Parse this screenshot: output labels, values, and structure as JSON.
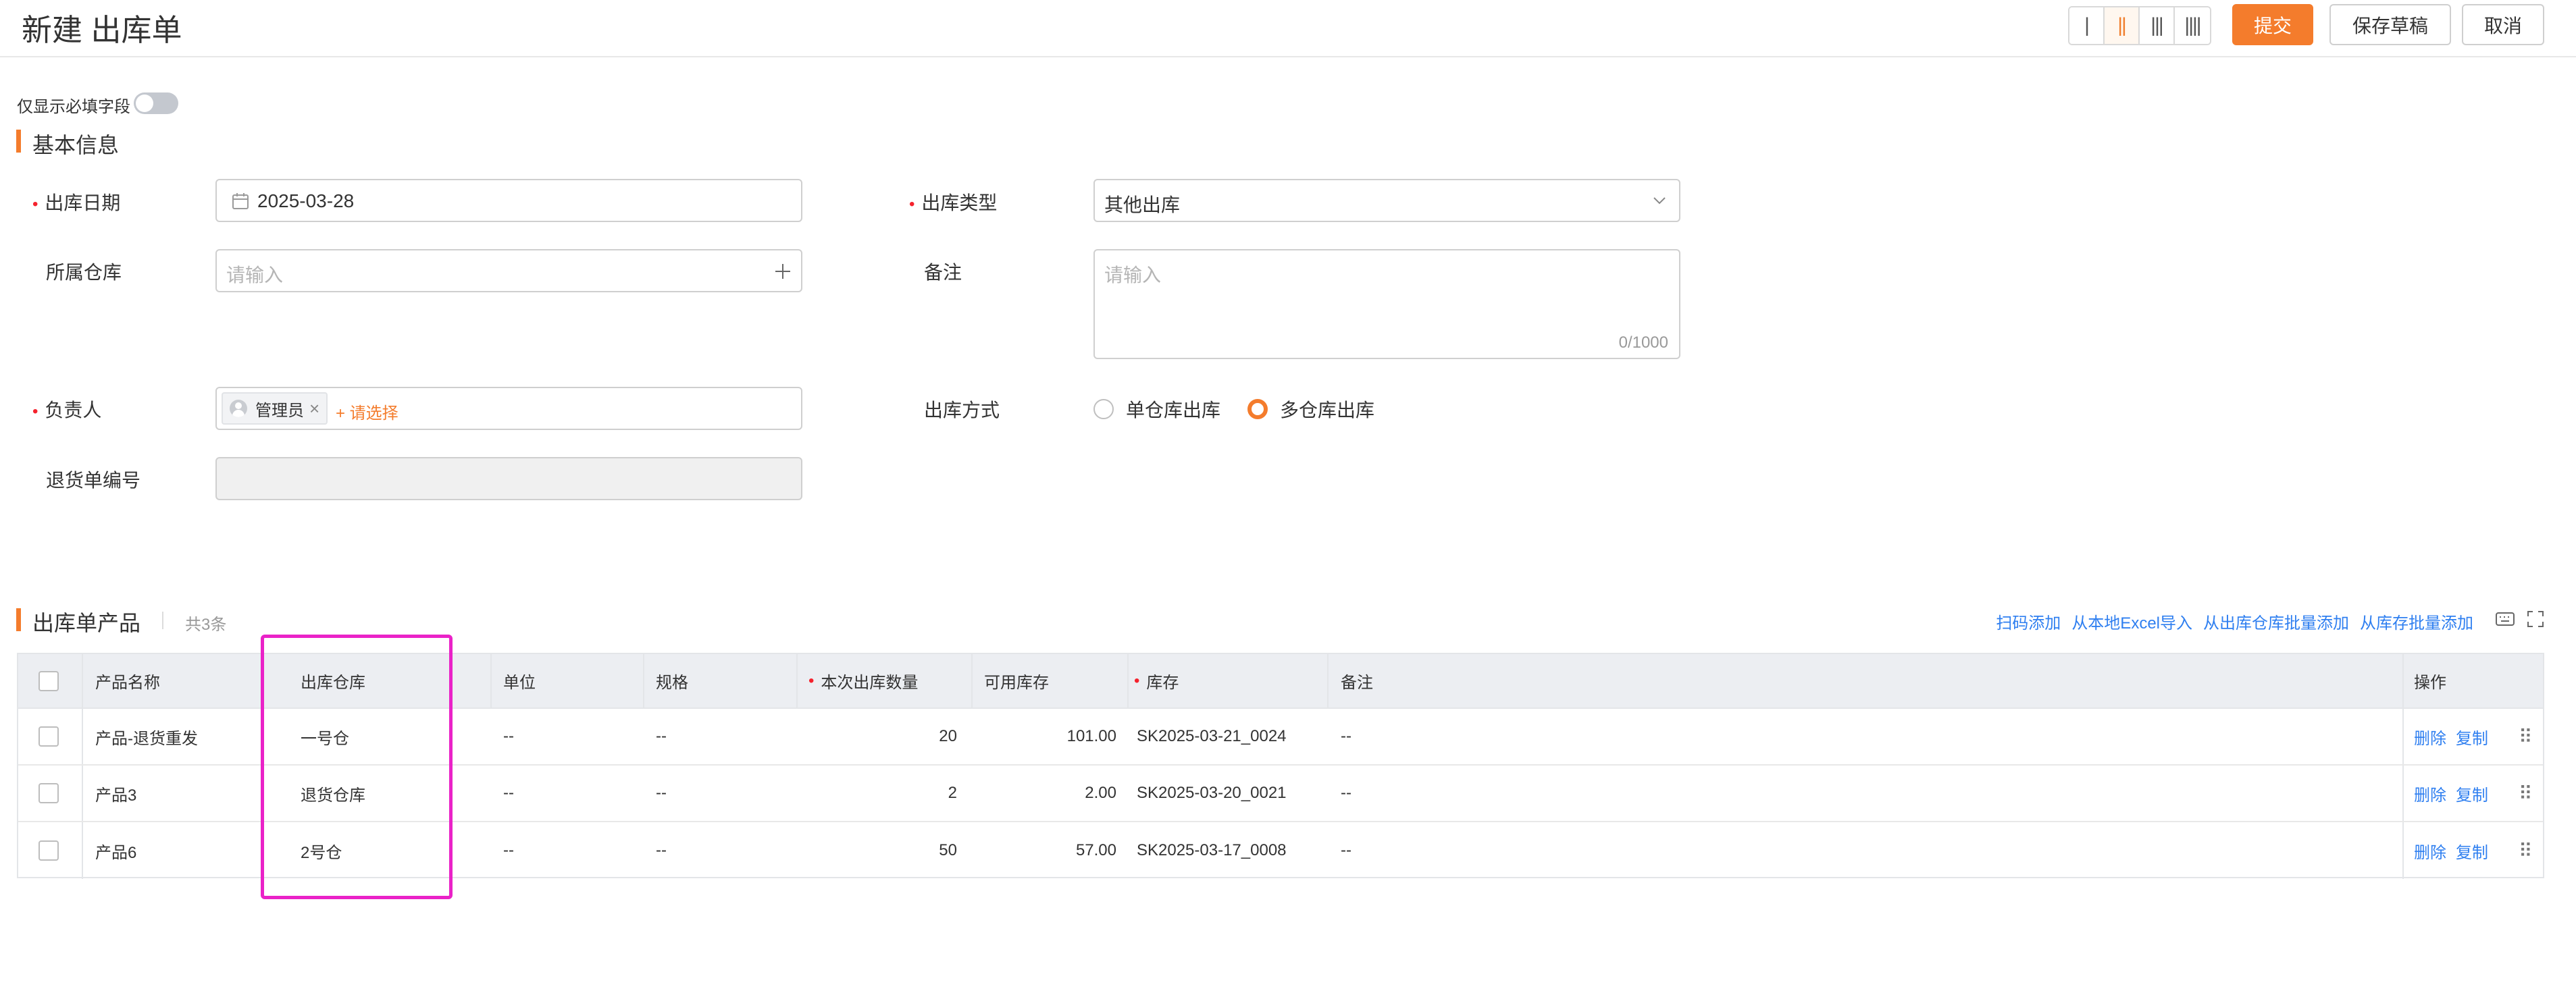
{
  "page": {
    "title": "新建 出库单"
  },
  "toolbar": {
    "layouts": [
      "|",
      "||",
      "|||",
      "||||"
    ],
    "submit": "提交",
    "save_draft": "保存草稿",
    "cancel": "取消"
  },
  "required_toggle": {
    "label": "仅显示必填字段"
  },
  "basic_info": {
    "title": "基本信息",
    "out_date": {
      "label": "出库日期",
      "value": "2025-03-28"
    },
    "out_type": {
      "label": "出库类型",
      "value": "其他出库"
    },
    "warehouse": {
      "label": "所属仓库",
      "placeholder": "请输入"
    },
    "remark": {
      "label": "备注",
      "placeholder": "请输入",
      "counter": "0/1000"
    },
    "owner": {
      "label": "负责人",
      "tag": "管理员",
      "select_link": "+ 请选择"
    },
    "out_mode": {
      "label": "出库方式",
      "option_single": "单仓库出库",
      "option_multi": "多仓库出库"
    },
    "return_no": {
      "label": "退货单编号"
    }
  },
  "products": {
    "title": "出库单产品",
    "count": "共3条",
    "actions": [
      "扫码添加",
      "从本地Excel导入",
      "从出库仓库批量添加",
      "从库存批量添加"
    ],
    "headers": {
      "name": "产品名称",
      "warehouse": "出库仓库",
      "unit": "单位",
      "spec": "规格",
      "qty": "本次出库数量",
      "available": "可用库存",
      "stock": "库存",
      "remark": "备注",
      "ops": "操作"
    },
    "rows": [
      {
        "name": "产品-退货重发",
        "warehouse": "一号仓",
        "unit": "--",
        "spec": "--",
        "qty": "20",
        "available": "101.00",
        "stock": "SK2025-03-21_0024",
        "remark": "--",
        "del": "删除",
        "copy": "复制"
      },
      {
        "name": "产品3",
        "warehouse": "退货仓库",
        "unit": "--",
        "spec": "--",
        "qty": "2",
        "available": "2.00",
        "stock": "SK2025-03-20_0021",
        "remark": "--",
        "del": "删除",
        "copy": "复制"
      },
      {
        "name": "产品6",
        "warehouse": "2号仓",
        "unit": "--",
        "spec": "--",
        "qty": "50",
        "available": "57.00",
        "stock": "SK2025-03-17_0008",
        "remark": "--",
        "del": "删除",
        "copy": "复制"
      }
    ]
  },
  "colors": {
    "accent": "#f47c2c",
    "link": "#2f7ff0",
    "highlight": "#ea22c8"
  }
}
